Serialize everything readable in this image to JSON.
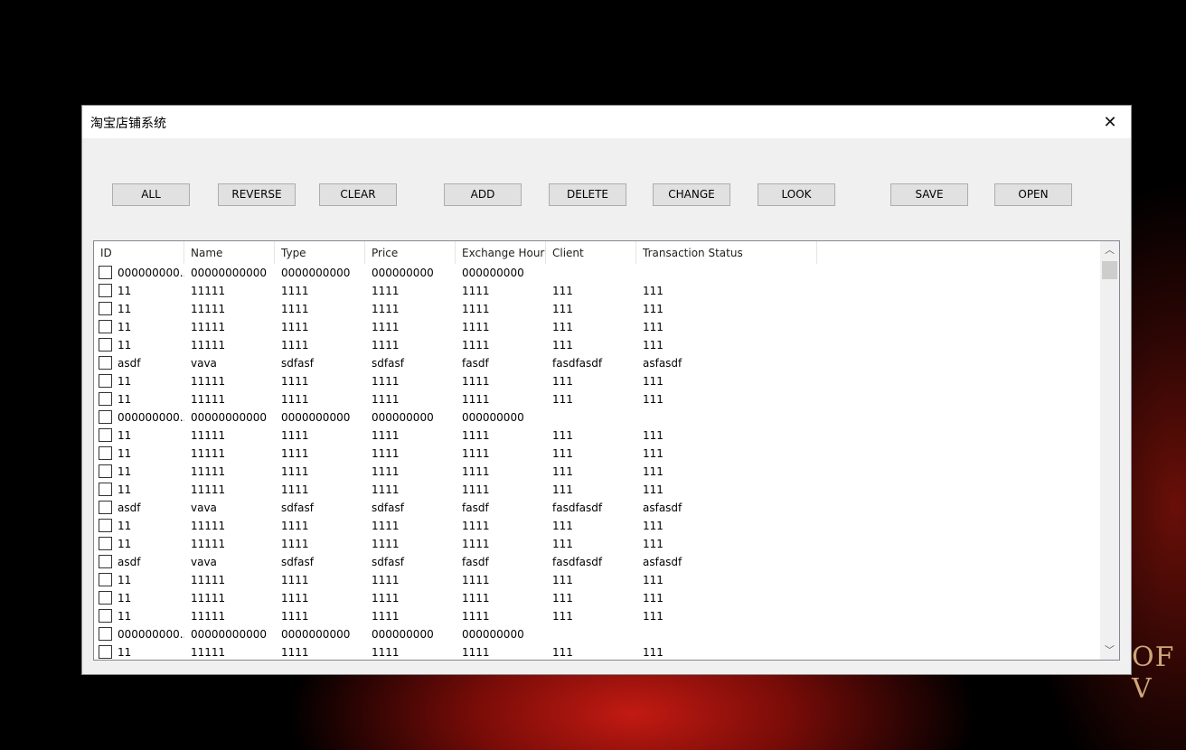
{
  "window": {
    "title": "淘宝店铺系统"
  },
  "toolbar": {
    "buttons": [
      "ALL",
      "REVERSE",
      "CLEAR",
      "ADD",
      "DELETE",
      "CHANGE",
      "LOOK",
      "SAVE",
      "OPEN"
    ]
  },
  "table": {
    "columns": [
      "ID",
      "Name",
      "Type",
      "Price",
      "Exchange Hour",
      "Client",
      "Transaction Status"
    ],
    "rows": [
      [
        "000000000...",
        "00000000000",
        "0000000000",
        "000000000",
        "000000000",
        "",
        ""
      ],
      [
        "11",
        "11111",
        "1111",
        "1111",
        "1111",
        "111",
        "111"
      ],
      [
        "11",
        "11111",
        "1111",
        "1111",
        "1111",
        "111",
        "111"
      ],
      [
        "11",
        "11111",
        "1111",
        "1111",
        "1111",
        "111",
        "111"
      ],
      [
        "11",
        "11111",
        "1111",
        "1111",
        "1111",
        "111",
        "111"
      ],
      [
        "asdf",
        "vava",
        "sdfasf",
        "sdfasf",
        "fasdf",
        "fasdfasdf",
        "asfasdf"
      ],
      [
        "11",
        "11111",
        "1111",
        "1111",
        "1111",
        "111",
        "111"
      ],
      [
        "11",
        "11111",
        "1111",
        "1111",
        "1111",
        "111",
        "111"
      ],
      [
        "000000000...",
        "00000000000",
        "0000000000",
        "000000000",
        "000000000",
        "",
        ""
      ],
      [
        "11",
        "11111",
        "1111",
        "1111",
        "1111",
        "111",
        "111"
      ],
      [
        "11",
        "11111",
        "1111",
        "1111",
        "1111",
        "111",
        "111"
      ],
      [
        "11",
        "11111",
        "1111",
        "1111",
        "1111",
        "111",
        "111"
      ],
      [
        "11",
        "11111",
        "1111",
        "1111",
        "1111",
        "111",
        "111"
      ],
      [
        "asdf",
        "vava",
        "sdfasf",
        "sdfasf",
        "fasdf",
        "fasdfasdf",
        "asfasdf"
      ],
      [
        "11",
        "11111",
        "1111",
        "1111",
        "1111",
        "111",
        "111"
      ],
      [
        "11",
        "11111",
        "1111",
        "1111",
        "1111",
        "111",
        "111"
      ],
      [
        "asdf",
        "vava",
        "sdfasf",
        "sdfasf",
        "fasdf",
        "fasdfasdf",
        "asfasdf"
      ],
      [
        "11",
        "11111",
        "1111",
        "1111",
        "1111",
        "111",
        "111"
      ],
      [
        "11",
        "11111",
        "1111",
        "1111",
        "1111",
        "111",
        "111"
      ],
      [
        "11",
        "11111",
        "1111",
        "1111",
        "1111",
        "111",
        "111"
      ],
      [
        "000000000...",
        "00000000000",
        "0000000000",
        "000000000",
        "000000000",
        "",
        ""
      ],
      [
        "11",
        "11111",
        "1111",
        "1111",
        "1111",
        "111",
        "111"
      ]
    ]
  },
  "background": {
    "text_fragments": [
      "OF V"
    ]
  },
  "colors": {
    "window_bg": "#f0f0f0",
    "button_bg": "#e1e1e1",
    "button_border": "#adadad"
  },
  "icons": {
    "close": "close-icon",
    "scroll_up": "chevron-up-icon",
    "scroll_down": "chevron-down-icon"
  }
}
